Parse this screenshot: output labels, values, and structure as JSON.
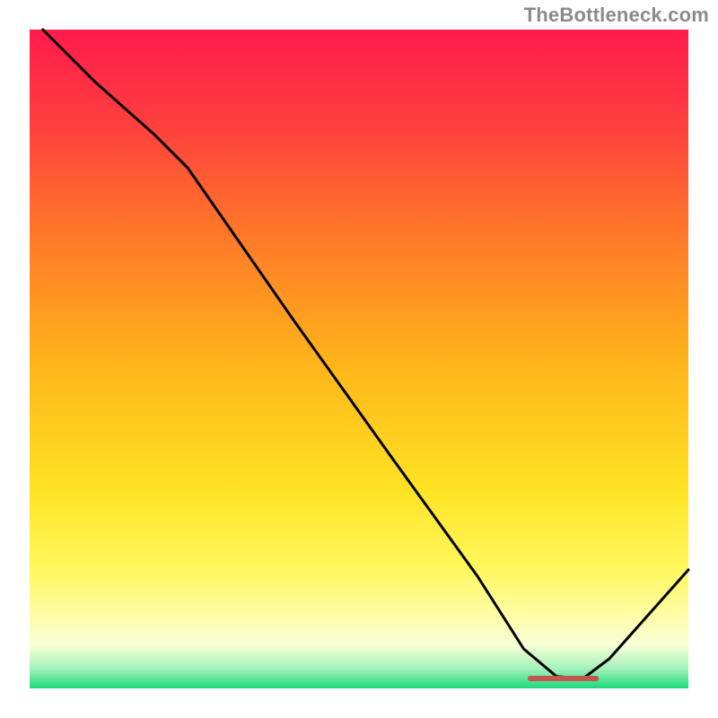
{
  "watermark": {
    "text": "TheBottleneck.com"
  },
  "chart_data": {
    "type": "line",
    "title": "",
    "xlabel": "",
    "ylabel": "",
    "xlim": [
      0,
      100
    ],
    "ylim": [
      0,
      100
    ],
    "grid": false,
    "legend": false,
    "background_gradient_stops": [
      {
        "offset": 0.0,
        "color": "#ff1b4b"
      },
      {
        "offset": 0.145,
        "color": "#ff3f3f"
      },
      {
        "offset": 0.28,
        "color": "#ff6e2c"
      },
      {
        "offset": 0.5,
        "color": "#ffb21a"
      },
      {
        "offset": 0.7,
        "color": "#ffe324"
      },
      {
        "offset": 0.82,
        "color": "#fff85e"
      },
      {
        "offset": 0.89,
        "color": "#fffca8"
      },
      {
        "offset": 0.935,
        "color": "#f6ffd6"
      },
      {
        "offset": 0.97,
        "color": "#a4f2bb"
      },
      {
        "offset": 1.0,
        "color": "#1bd97b"
      }
    ],
    "series": [
      {
        "name": "bottleneck-curve",
        "color": "#000000",
        "stroke_width": 3,
        "x": [
          2,
          10,
          19,
          24,
          40,
          55,
          68,
          75,
          80,
          84,
          88,
          100
        ],
        "y": [
          100,
          92,
          84,
          79,
          56,
          35,
          17,
          6,
          1.8,
          1.5,
          4.5,
          18
        ]
      }
    ],
    "marker": {
      "name": "optimal-range",
      "color": "#c0564e",
      "x_start": 76,
      "x_end": 86,
      "y": 1.5,
      "thickness": 6
    }
  }
}
